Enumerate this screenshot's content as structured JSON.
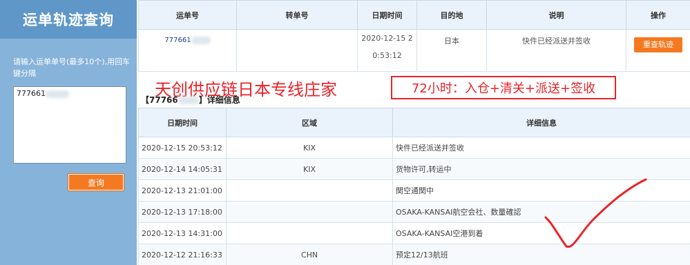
{
  "sidebar": {
    "title": "运单轨迹查询",
    "hint": "请输入运单单号(最多10个),用回车键分隔",
    "textarea_value": "777661",
    "query_button": "查询"
  },
  "top_table": {
    "headers": [
      "运单号",
      "转单号",
      "日期时间",
      "目的地",
      "说明",
      "操作"
    ],
    "row": {
      "waybill": "777661",
      "transfer": "",
      "date_line1": "2020-12-15 2",
      "date_line2": "0:53:12",
      "destination": "日本",
      "description": "快件已经派送并签收",
      "action": "重查轨迹"
    }
  },
  "banner": {
    "left_text": "天创供应链日本专线庄家",
    "box_text": "72小时：入仓+清关+派送+签收"
  },
  "detail": {
    "heading_prefix": "【77766",
    "heading_suffix": "】详细信息",
    "headers": [
      "日期时间",
      "区域",
      "详细信息"
    ],
    "rows": [
      {
        "datetime": "2020-12-15 20:53:12",
        "area": "KIX",
        "info": "快件已经派送并签收"
      },
      {
        "datetime": "2020-12-14 14:05:31",
        "area": "KIX",
        "info": "货物许可,转运中"
      },
      {
        "datetime": "2020-12-13 21:01:00",
        "area": "",
        "info": "関空通関中"
      },
      {
        "datetime": "2020-12-13 17:18:00",
        "area": "",
        "info": "OSAKA-KANSAI航空会社、数量確認"
      },
      {
        "datetime": "2020-12-13 14:31:00",
        "area": "",
        "info": "OSAKA-KANSAI空港到着"
      },
      {
        "datetime": "2020-12-12 21:16:33",
        "area": "CHN",
        "info": "预定12/13航班"
      }
    ]
  },
  "colors": {
    "sidebar_bg": "#86b3d9",
    "sidebar_title_bg": "#5f97c9",
    "accent_orange": "#f47920",
    "annotation_red": "#e8232a"
  }
}
